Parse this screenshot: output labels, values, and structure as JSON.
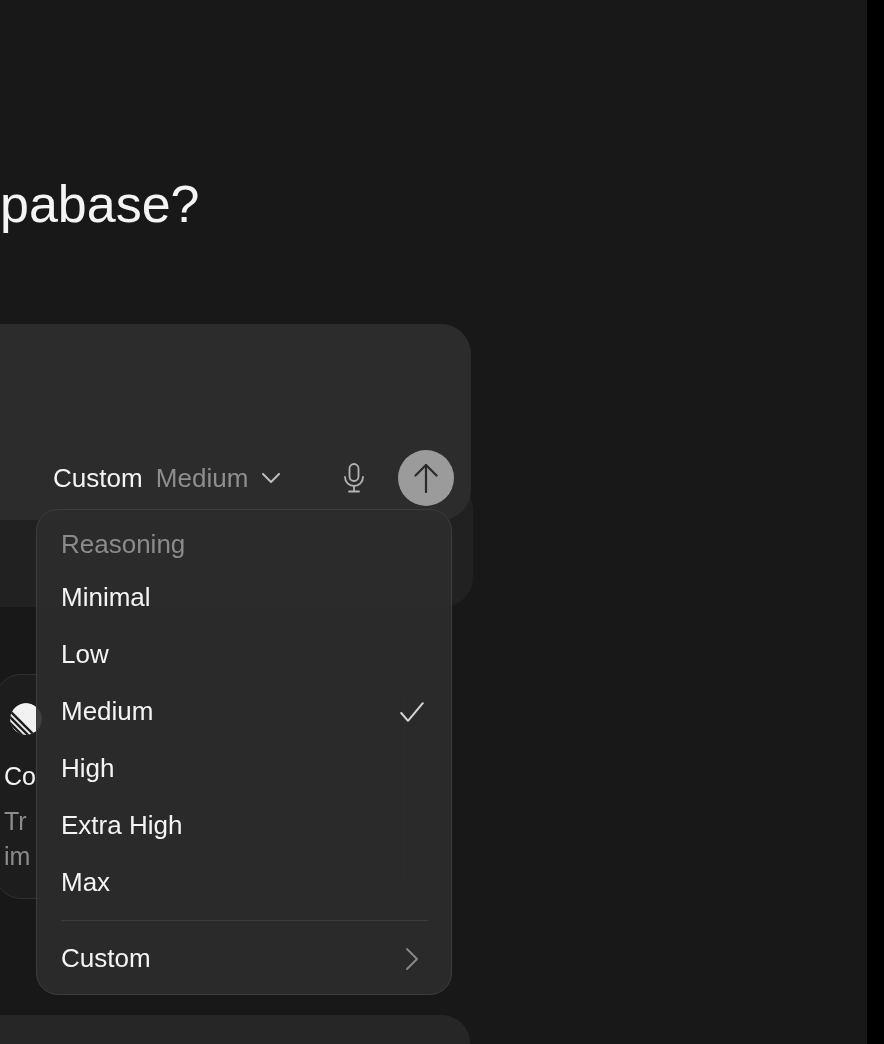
{
  "heading": "pabase?",
  "composer": {
    "reasoning_picker": {
      "label": "Custom",
      "value": "Medium",
      "expanded": true
    },
    "send_button": {
      "disabled": true
    }
  },
  "reasoning_menu": {
    "header": "Reasoning",
    "options": [
      {
        "label": "Minimal",
        "selected": false
      },
      {
        "label": "Low",
        "selected": false
      },
      {
        "label": "Medium",
        "selected": true
      },
      {
        "label": "High",
        "selected": false
      },
      {
        "label": "Extra High",
        "selected": false
      },
      {
        "label": "Max",
        "selected": false
      }
    ],
    "submenu": {
      "label": "Custom"
    }
  },
  "integration_cards": [
    {
      "title": "Co",
      "description": "Tr im"
    }
  ]
}
